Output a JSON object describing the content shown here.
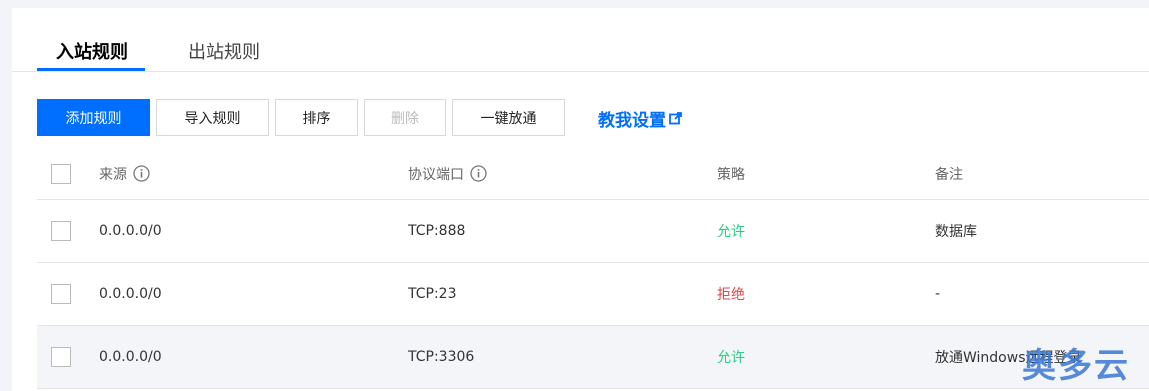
{
  "tabs": [
    {
      "label": "入站规则",
      "active": true
    },
    {
      "label": "出站规则",
      "active": false
    }
  ],
  "toolbar": {
    "add_label": "添加规则",
    "import_label": "导入规则",
    "sort_label": "排序",
    "delete_label": "删除",
    "open_all_label": "一键放通",
    "help_label": "教我设置"
  },
  "table": {
    "headers": {
      "source": "来源",
      "port": "协议端口",
      "policy": "策略",
      "note": "备注"
    },
    "rows": [
      {
        "source": "0.0.0.0/0",
        "port": "TCP:888",
        "policy": "允许",
        "note": "数据库"
      },
      {
        "source": "0.0.0.0/0",
        "port": "TCP:23",
        "policy": "拒绝",
        "note": "-"
      },
      {
        "source": "0.0.0.0/0",
        "port": "TCP:3306",
        "policy": "允许",
        "note": "放通Windows远程登录"
      }
    ]
  },
  "watermark": "奥多云",
  "colors": {
    "accent": "#006eff",
    "allow": "#29cc85",
    "deny": "#e54545"
  }
}
